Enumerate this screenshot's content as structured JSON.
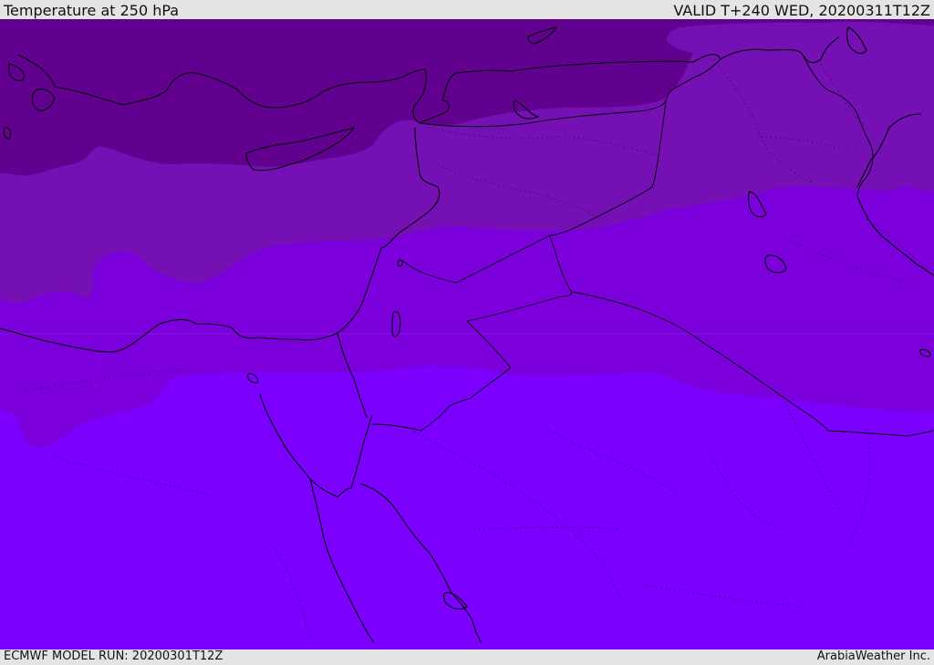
{
  "header": {
    "title": "Temperature at 250 hPa",
    "valid_time": "VALID T+240 WED, 20200311T12Z"
  },
  "footer": {
    "model_run": "ECMWF MODEL RUN: 20200301T12Z",
    "credit": "ArabiaWeather Inc."
  },
  "map": {
    "colors": {
      "band_darkest": "#620090",
      "band_dark": "#7410b4",
      "band_mid": "#7c00dc",
      "band_light": "#7b00fe",
      "coastline": "#000000",
      "borders_dotted": "#3a005a"
    }
  }
}
